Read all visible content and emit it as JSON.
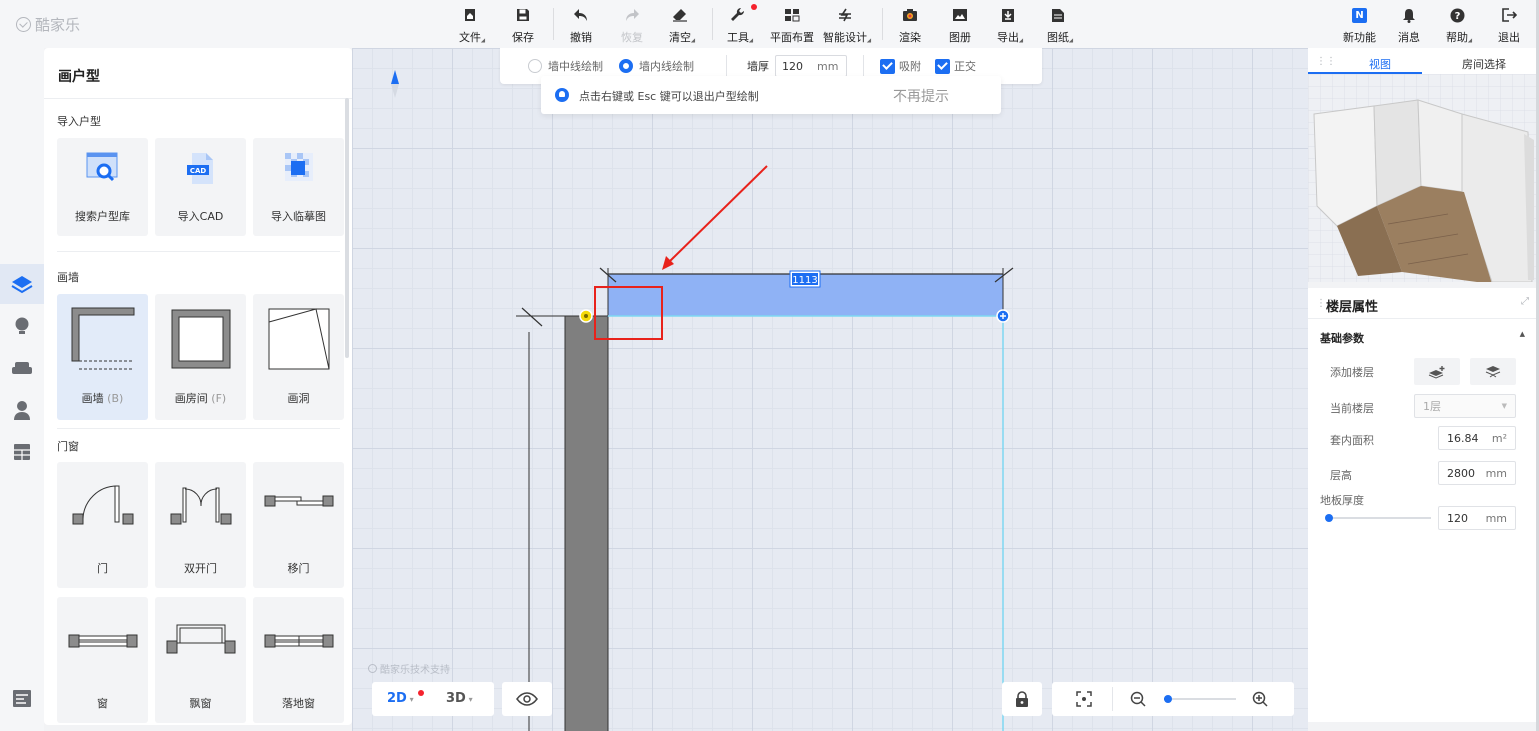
{
  "app": {
    "logo_text": "酷家乐"
  },
  "toolbar": {
    "file": "文件",
    "save": "保存",
    "undo": "撤销",
    "redo": "恢复",
    "clear": "清空",
    "tools": "工具",
    "floor_layout": "平面布置",
    "smart_design": "智能设计",
    "render": "渲染",
    "album": "图册",
    "export": "导出",
    "drawings": "图纸",
    "new_features": "新功能",
    "messages": "消息",
    "help": "帮助",
    "logout": "退出",
    "new_features_badge": "N"
  },
  "left_panel": {
    "title": "画户型",
    "sections": {
      "import": {
        "title": "导入户型",
        "items": [
          {
            "label": "搜索户型库",
            "icon": "search-floorplan-icon"
          },
          {
            "label": "导入CAD",
            "icon": "cad-file-icon",
            "badge": "CAD"
          },
          {
            "label": "导入临摹图",
            "icon": "trace-image-icon"
          }
        ]
      },
      "walls": {
        "title": "画墙",
        "items": [
          {
            "label": "画墙",
            "hotkey": "(B)",
            "icon": "draw-wall-icon",
            "selected": true
          },
          {
            "label": "画房间",
            "hotkey": "(F)",
            "icon": "draw-room-icon"
          },
          {
            "label": "画洞",
            "icon": "draw-hole-icon"
          }
        ]
      },
      "doors": {
        "title": "门窗",
        "items": [
          {
            "label": "门",
            "icon": "door-icon"
          },
          {
            "label": "双开门",
            "icon": "double-door-icon"
          },
          {
            "label": "移门",
            "icon": "sliding-door-icon"
          },
          {
            "label": "窗",
            "icon": "window-icon"
          },
          {
            "label": "飘窗",
            "icon": "bay-window-icon"
          },
          {
            "label": "落地窗",
            "icon": "french-window-icon"
          }
        ]
      }
    }
  },
  "draw_bar": {
    "centerline_label": "墙中线绘制",
    "inner_label": "墙内线绘制",
    "thickness_label": "墙厚",
    "thickness_value": "120",
    "thickness_unit": "mm",
    "snap_label": "吸附",
    "ortho_label": "正交",
    "mode": "inner"
  },
  "tip": {
    "message": "点击右键或 Esc 键可以退出户型绘制",
    "dismiss": "不再提示"
  },
  "canvas": {
    "dimension_label": "1113",
    "watermark": "酷家乐技术支持",
    "view_2d": "2D",
    "view_3d": "3D",
    "zoom_level": 0.05,
    "colors": {
      "wall_preview": "#8fb2f5",
      "existing_wall": "#7f7f7f",
      "annotation": "#e8221b",
      "guide": "#7fd8f2"
    }
  },
  "right_panel": {
    "tabs": [
      "视图",
      "房间选择"
    ],
    "active_tab": "视图",
    "props_title": "楼层属性",
    "basic_params": "基础参数",
    "add_floor_label": "添加楼层",
    "current_floor_label": "当前楼层",
    "current_floor_value": "1层",
    "area_label": "套内面积",
    "area_value": "16.84",
    "area_unit": "m²",
    "height_label": "层高",
    "height_value": "2800",
    "height_unit": "mm",
    "slab_label": "地板厚度",
    "slab_value": "120",
    "slab_unit": "mm",
    "slab_slider_level": 0.0
  }
}
